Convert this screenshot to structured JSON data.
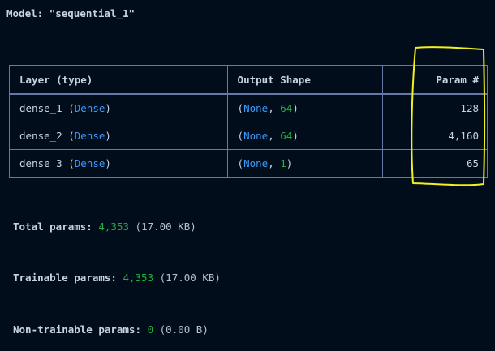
{
  "model": {
    "label": "Model:",
    "name": "\"sequential_1\""
  },
  "table": {
    "headers": {
      "layer": "Layer (type)",
      "shape": "Output Shape",
      "params": "Param #"
    },
    "rows": [
      {
        "name": "dense_1",
        "open": "(",
        "cls": "Dense",
        "close": ")",
        "shape_none": "None",
        "shape_sep": ", ",
        "shape_dim": "64",
        "shape_close": ")",
        "params": "128"
      },
      {
        "name": "dense_2",
        "open": "(",
        "cls": "Dense",
        "close": ")",
        "shape_none": "None",
        "shape_sep": ", ",
        "shape_dim": "64",
        "shape_close": ")",
        "params": "4,160"
      },
      {
        "name": "dense_3",
        "open": "(",
        "cls": "Dense",
        "close": ")",
        "shape_none": "None",
        "shape_sep": ", ",
        "shape_dim": "1",
        "shape_close": ")",
        "params": "65"
      }
    ]
  },
  "stats": {
    "total": {
      "label": "Total params:",
      "value": "4,353",
      "size": "(17.00 KB)"
    },
    "trainable": {
      "label": "Trainable params:",
      "value": "4,353",
      "size": "(17.00 KB)"
    },
    "non_trainable": {
      "label": "Non-trainable params:",
      "value": "0",
      "size": "(0.00 B)"
    }
  },
  "colors": {
    "background": "#010d1a",
    "text": "#c9d1e3",
    "border": "#6678a8",
    "class_name": "#3b9cff",
    "number": "#21b13d",
    "highlight": "#f3f020"
  }
}
